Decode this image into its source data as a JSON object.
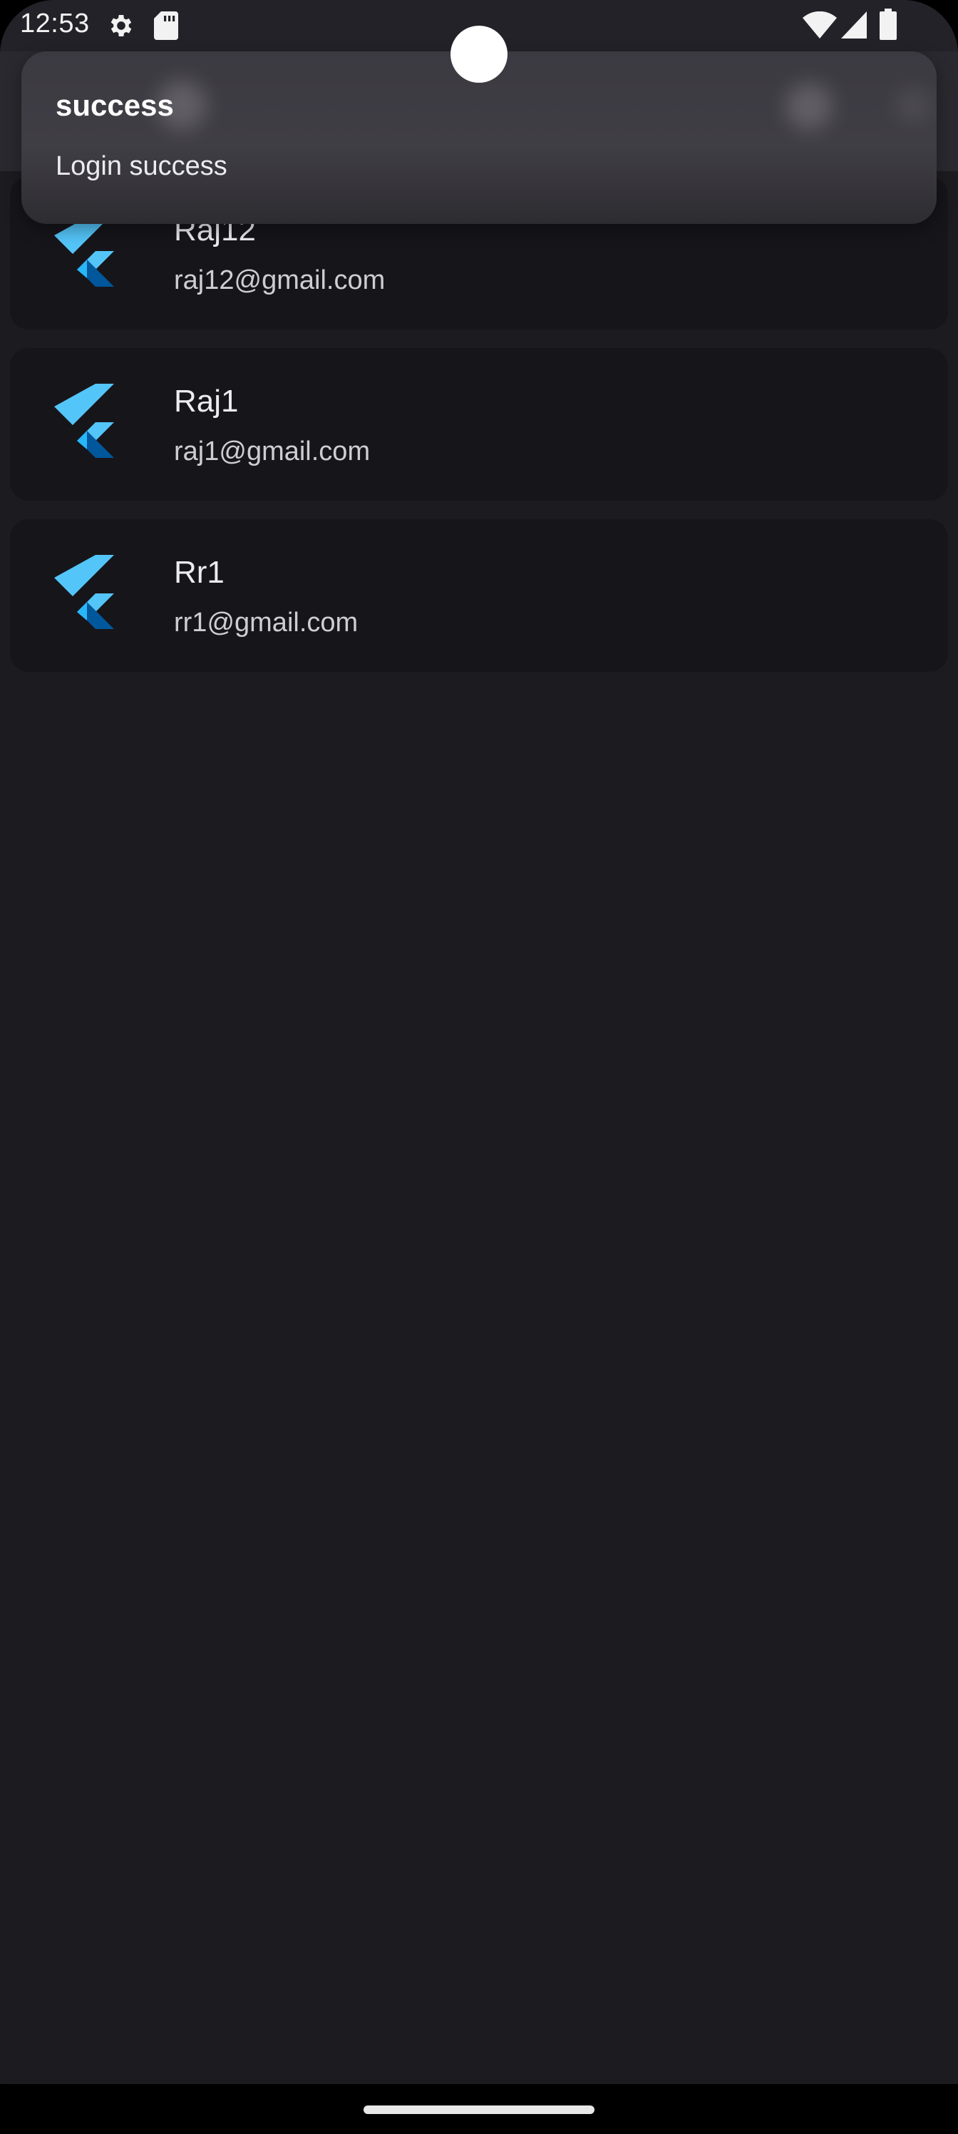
{
  "status_bar": {
    "time": "12:53",
    "icons": [
      "settings-icon",
      "sd-card-icon",
      "wifi-icon",
      "cellular-icon",
      "battery-icon"
    ]
  },
  "toast": {
    "title": "success",
    "message": "Login success"
  },
  "users": [
    {
      "name": "Raj12",
      "email": "raj12@gmail.com",
      "icon": "flutter-logo-icon"
    },
    {
      "name": "Raj1",
      "email": "raj1@gmail.com",
      "icon": "flutter-logo-icon"
    },
    {
      "name": "Rr1",
      "email": "rr1@gmail.com",
      "icon": "flutter-logo-icon"
    }
  ],
  "colors": {
    "background": "#1c1b20",
    "card": "#16151a",
    "toast": "#3e3c43",
    "flutter_light": "#54c5f8",
    "flutter_dark": "#01579b"
  }
}
